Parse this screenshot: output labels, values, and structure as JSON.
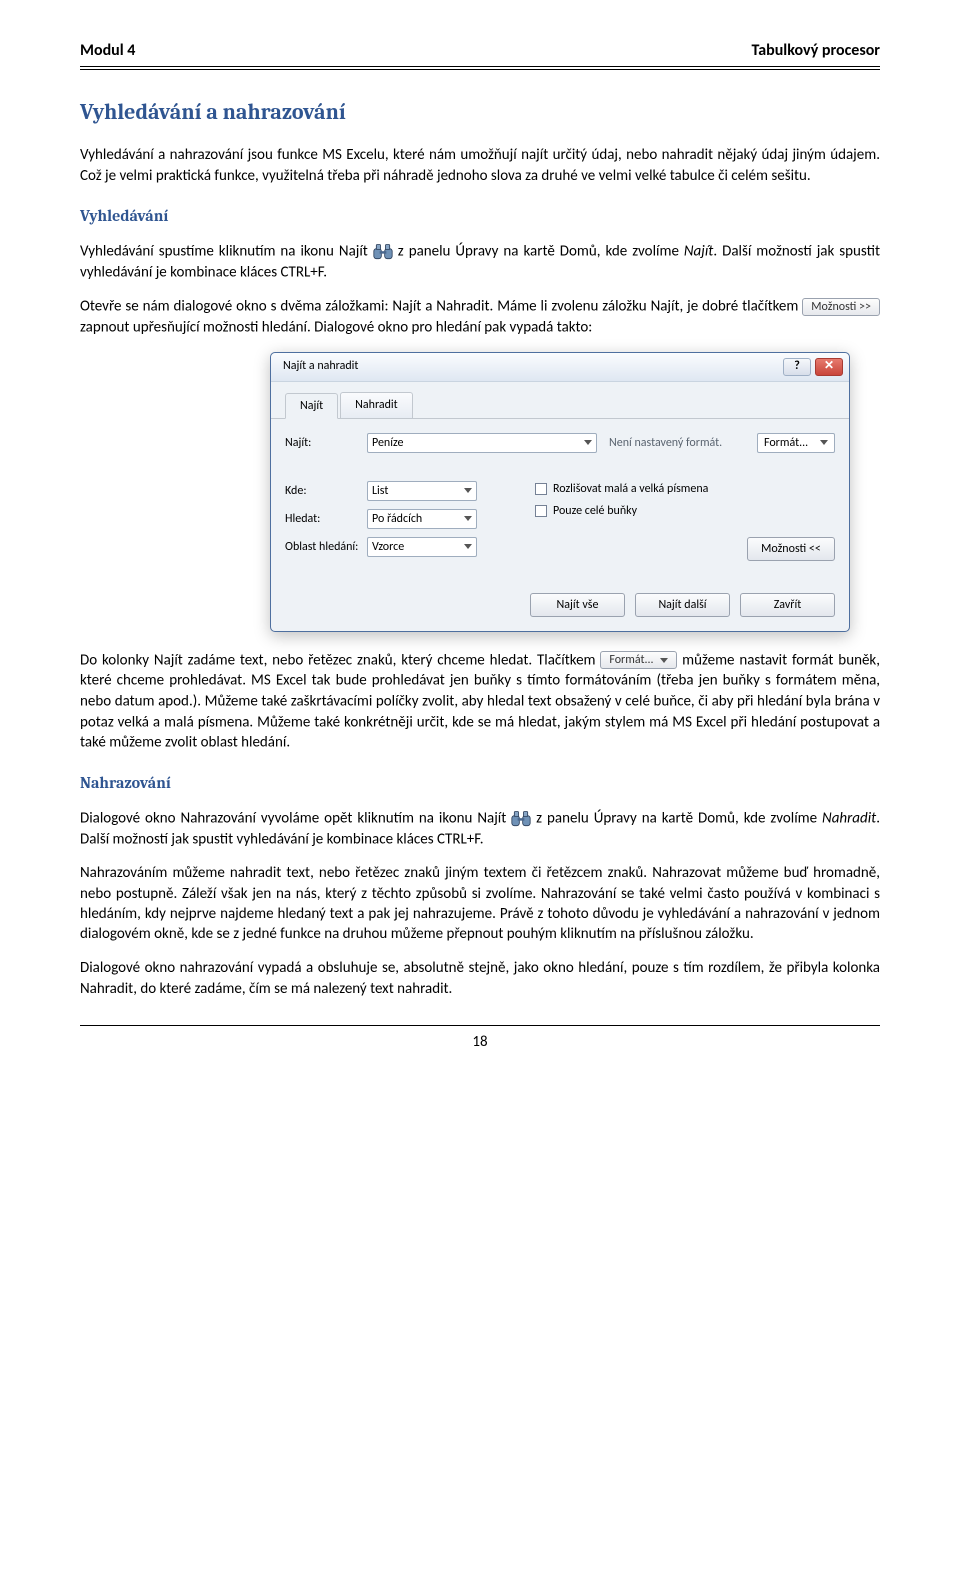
{
  "header": {
    "left": "Modul 4",
    "right": "Tabulkový procesor"
  },
  "h_main": "Vyhledávání a nahrazování",
  "intro_p1": "Vyhledávání a nahrazování jsou funkce MS Excelu, které nám umožňují najít určitý údaj, nebo nahradit nějaký údaj jiným údajem. Což je velmi praktická funkce, využitelná třeba při náhradě jednoho slova za druhé ve velmi velké tabulce či celém sešitu.",
  "h_search": "Vyhledávání",
  "search_p1_a": "Vyhledávání spustíme kliknutím na ikonu Najít ",
  "search_p1_b": " z panelu Úpravy na kartě Domů, kde zvolíme ",
  "search_p1_italic": "Najít",
  "search_p1_c": ". Další možností jak spustit vyhledávání je kombinace kláces CTRL+F.",
  "search_p2_a": "Otevře se nám dialogové okno s dvěma záložkami: Najít a Nahradit. Máme li zvolenu záložku Najít, je dobré tlačítkem ",
  "btn_options_more": "Možnosti >>",
  "search_p2_b": " zapnout upřesňující možnosti hledání. Dialogové okno pro hledání pak vypadá takto:",
  "dialog": {
    "title": "Najít a nahradit",
    "tab1": "Najít",
    "tab2": "Nahradit",
    "lbl_find": "Najít:",
    "val_find": "Peníze",
    "no_format": "Není nastavený formát.",
    "btn_format": "Formát...",
    "lbl_where": "Kde:",
    "val_where": "List",
    "lbl_how": "Hledat:",
    "val_how": "Po řádcích",
    "lbl_area": "Oblast hledání:",
    "val_area": "Vzorce",
    "ck_case": "Rozlišovat malá a velká písmena",
    "ck_whole": "Pouze celé buňky",
    "btn_options_less": "Možnosti <<",
    "btn_findall": "Najít vše",
    "btn_findnext": "Najít další",
    "btn_close": "Zavřít"
  },
  "after_p1_a": "Do kolonky Najít zadáme text, nebo řetězec znaků, který chceme hledat. Tlačítkem ",
  "btn_format2": "Formát...",
  "after_p1_b": " můžeme nastavit formát buněk, které chceme prohledávat. MS Excel tak bude prohledávat jen buňky s tímto formátováním (třeba jen buňky s formátem měna, nebo datum apod.). Můžeme také zaškrtávacími políčky zvolit, aby hledal text obsažený v celé buňce, či aby při hledání byla brána v potaz velká a malá písmena. Můžeme také konkrétněji určit, kde se má hledat, jakým stylem má MS Excel při hledání postupovat a také můžeme zvolit oblast hledání.",
  "h_replace": "Nahrazování",
  "replace_p1_a": "Dialogové okno Nahrazování vyvoláme opět kliknutím na ikonu Najít ",
  "replace_p1_b": " z panelu Úpravy na kartě Domů, kde zvolíme ",
  "replace_p1_italic": "Nahradit",
  "replace_p1_c": ". Další možností jak spustit vyhledávání je kombinace kláces CTRL+F.",
  "replace_p2": "Nahrazováním můžeme nahradit text, nebo řetězec znaků jiným textem či řetězcem znaků. Nahrazovat můžeme buď hromadně, nebo postupně. Záleží však jen na nás, který z těchto způsobů si zvolíme. Nahrazování se také velmi často používá v kombinaci s hledáním, kdy nejprve najdeme hledaný text a pak jej nahrazujeme. Právě z tohoto důvodu je vyhledávání a nahrazování v jednom dialogovém okně, kde se z jedné funkce na druhou můžeme přepnout pouhým kliknutím na příslušnou záložku.",
  "replace_p3": "Dialogové okno nahrazování vypadá a obsluhuje se, absolutně stejně, jako okno hledání, pouze s tím rozdílem, že přibyla kolonka Nahradit, do které zadáme, čím se má nalezený text nahradit.",
  "page_no": "18"
}
